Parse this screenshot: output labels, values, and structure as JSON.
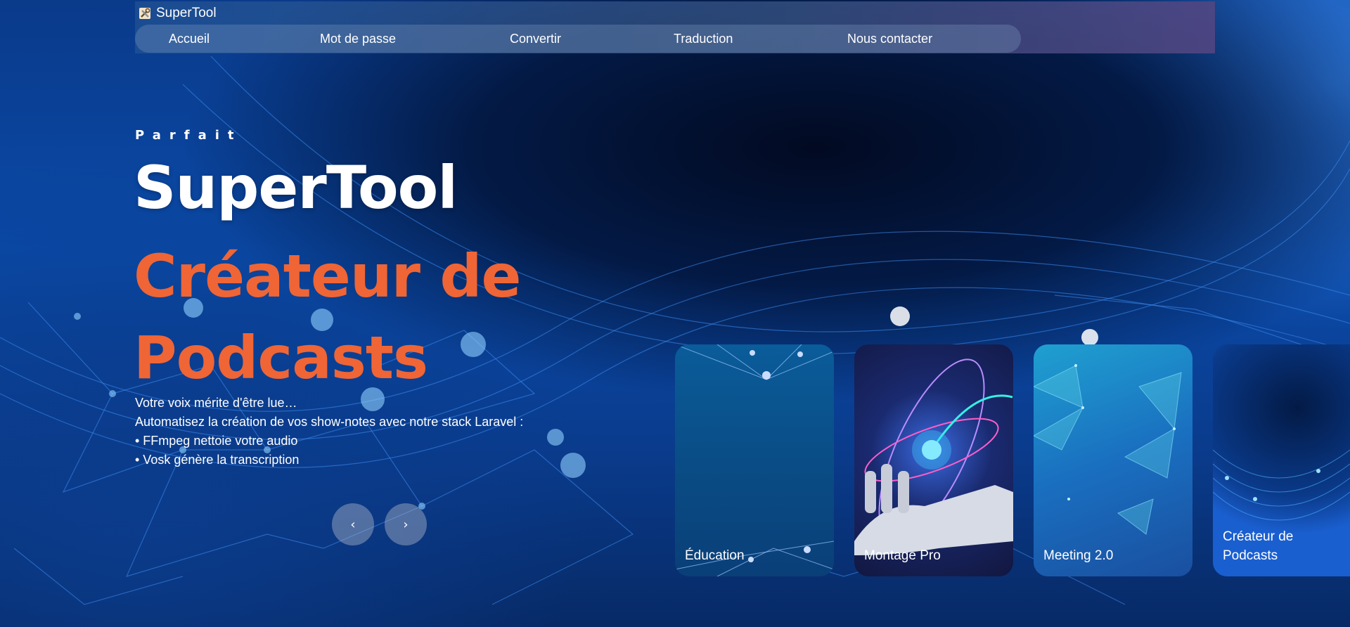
{
  "brand": {
    "icon": "tools-icon",
    "name": "SuperTool"
  },
  "nav": {
    "items": [
      {
        "label": "Accueil"
      },
      {
        "label": "Mot de passe"
      },
      {
        "label": "Convertir"
      },
      {
        "label": "Traduction"
      },
      {
        "label": "Nous contacter"
      }
    ]
  },
  "hero": {
    "eyebrow": "Parfait",
    "title": "SuperTool",
    "subtitle": "Créateur de Podcasts",
    "description": [
      "Votre voix mérite d'être lue…",
      "Automatisez la création de vos show-notes avec notre stack Laravel :",
      "• FFmpeg nettoie votre audio",
      "• Vosk génère la transcription"
    ],
    "prev_icon": "chevron-left-icon",
    "prev_glyph": "‹",
    "next_icon": "chevron-right-icon",
    "next_glyph": "›"
  },
  "cards": [
    {
      "label": "Éducation"
    },
    {
      "label": "Montage Pro"
    },
    {
      "label": "Meeting 2.0"
    },
    {
      "label": "Créateur de Podcasts"
    }
  ],
  "colors": {
    "accent": "#ef6535",
    "background": "#0a4aa8"
  }
}
